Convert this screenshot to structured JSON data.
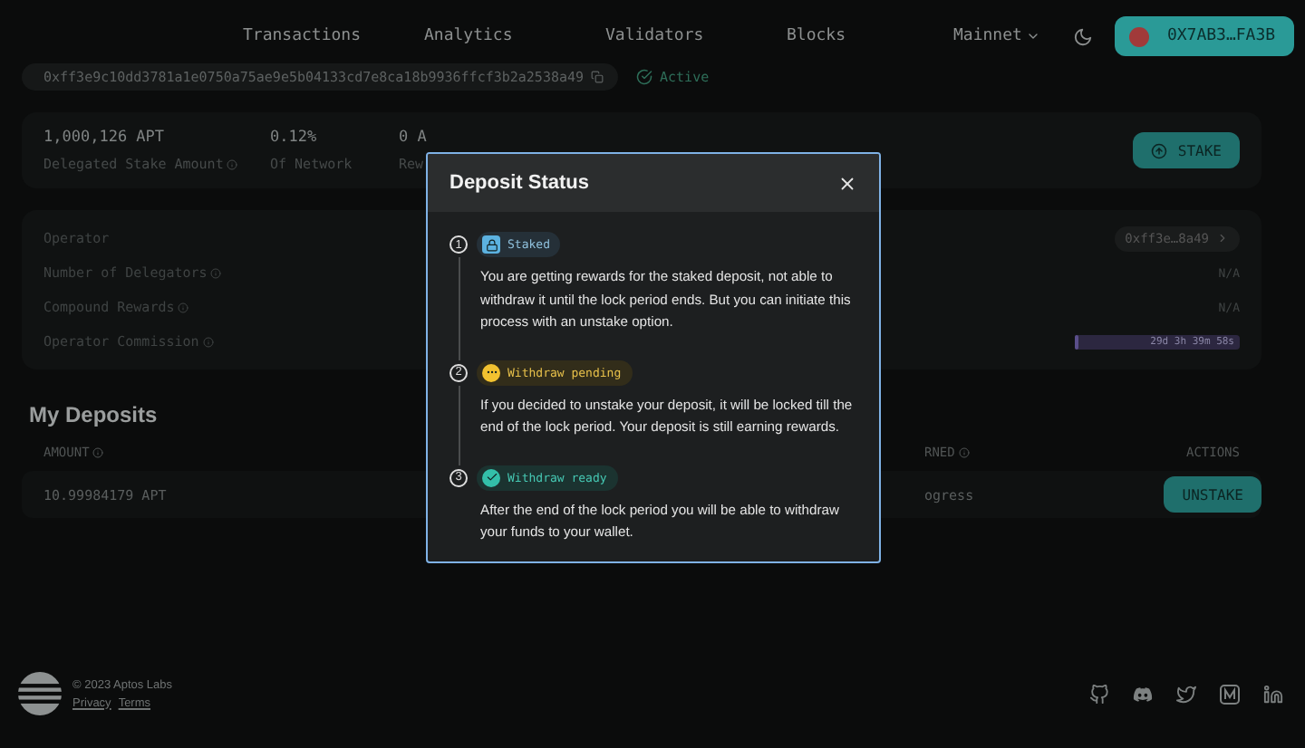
{
  "nav": {
    "links": [
      "Transactions",
      "Analytics",
      "Validators",
      "Blocks"
    ],
    "network": "Mainnet",
    "wallet": "0X7AB3…FA3B"
  },
  "validator": {
    "address": "0xff3e9c10dd3781a1e0750a75ae9e5b04133cd7e8ca18b9936ffcf3b2a2538a49",
    "status": "Active"
  },
  "stats": [
    {
      "value": "1,000,126 APT",
      "label": "Delegated Stake Amount",
      "info": true
    },
    {
      "value": "0.12%",
      "label": "Of Network",
      "info": false
    },
    {
      "value": "0 A",
      "label": "Rew"
    }
  ],
  "stake_button": "STAKE",
  "details": [
    {
      "kind": "link",
      "label": "Operator",
      "info": false,
      "value": "0xff3e…8a49"
    },
    {
      "kind": "text",
      "label": "Number of Delegators",
      "info": true,
      "value": "N/A"
    },
    {
      "kind": "text",
      "label": "Compound Rewards",
      "info": true,
      "value": "N/A"
    },
    {
      "kind": "bar",
      "label": "Operator Commission",
      "info": true,
      "value": "29d 3h 39m 58s",
      "level": 0.02
    }
  ],
  "deposits": {
    "title": "My Deposits",
    "columns": [
      {
        "label": "AMOUNT",
        "info": true
      },
      {
        "label": "RNED",
        "info": true
      },
      {
        "label": "ACTIONS",
        "info": false
      }
    ],
    "rows": [
      {
        "amount": "10.99984179 APT",
        "status": "ogress",
        "action": "UNSTAKE"
      }
    ]
  },
  "modal": {
    "title": "Deposit Status",
    "steps": [
      {
        "number": "1",
        "kind": "staked",
        "badge": "Staked",
        "text": "You are getting rewards for the staked deposit, not able to withdraw it until the lock period ends. But you can initiate this process with an unstake option."
      },
      {
        "number": "2",
        "kind": "pending",
        "badge": "Withdraw pending",
        "text": "If you decided to unstake your deposit, it will be locked till the end of the lock period. Your deposit is still earning rewards."
      },
      {
        "number": "3",
        "kind": "ready",
        "badge": "Withdraw ready",
        "text": "After the end of the lock period you will be able to withdraw your funds to your wallet."
      }
    ]
  },
  "footer": {
    "copyright": "© 2023 Aptos Labs",
    "links": [
      "Privacy",
      "Terms"
    ]
  }
}
